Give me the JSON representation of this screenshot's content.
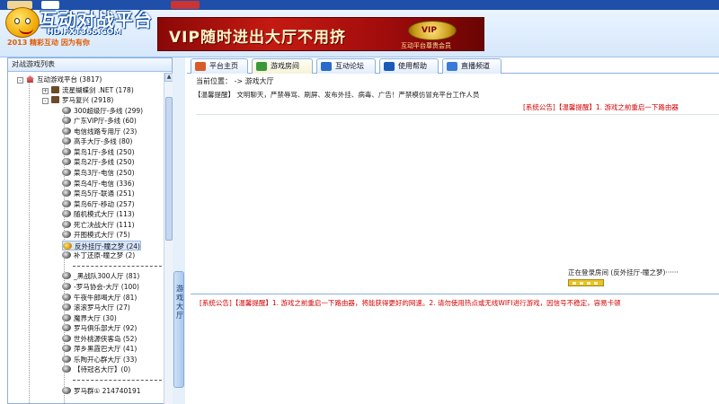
{
  "logo": {
    "title": "互动对战平台",
    "url": "HD.FXT365.COM",
    "slogan": "2013 精彩互动 因为有你"
  },
  "vip_banner": {
    "text": "VIP随时进出大厅不用挤",
    "badge": "VIP",
    "caption": "互动平台尊贵会员"
  },
  "left_panel": {
    "title": "对战游戏列表",
    "tree": [
      {
        "label": "互动游戏平台 (3817)",
        "level": 0,
        "icon": "house-icon",
        "expander": "-"
      },
      {
        "label": "流星蝴蝶剑 .NET (178)",
        "level": 1,
        "icon": "game-icon",
        "expander": "+"
      },
      {
        "label": "罗马复兴 (2918)",
        "level": 1,
        "icon": "game-icon",
        "expander": "-"
      },
      {
        "label": "300超级厅-多线 (299)",
        "level": 2,
        "icon": "room-icon"
      },
      {
        "label": "广东VIP厅-多线 (60)",
        "level": 2,
        "icon": "room-icon"
      },
      {
        "label": "电信线路专用厅 (23)",
        "level": 2,
        "icon": "room-icon"
      },
      {
        "label": "高手大厅-多线 (80)",
        "level": 2,
        "icon": "room-icon"
      },
      {
        "label": "菜鸟1厅-多线 (250)",
        "level": 2,
        "icon": "room-icon"
      },
      {
        "label": "菜鸟2厅-多线 (250)",
        "level": 2,
        "icon": "room-icon"
      },
      {
        "label": "菜鸟3厅-电信 (250)",
        "level": 2,
        "icon": "room-icon"
      },
      {
        "label": "菜鸟4厅-电信 (336)",
        "level": 2,
        "icon": "room-icon"
      },
      {
        "label": "菜鸟5厅-联通 (251)",
        "level": 2,
        "icon": "room-icon"
      },
      {
        "label": "菜鸟6厅-移动 (257)",
        "level": 2,
        "icon": "room-icon"
      },
      {
        "label": "随机模式大厅 (113)",
        "level": 2,
        "icon": "room-icon"
      },
      {
        "label": "死亡决战大厅 (111)",
        "level": 2,
        "icon": "room-icon"
      },
      {
        "label": "开图模式大厅 (75)",
        "level": 2,
        "icon": "room-icon"
      },
      {
        "label": "反外挂厅-瞳之梦 (24)",
        "level": 2,
        "icon": "gold-room-icon",
        "selected": true
      },
      {
        "label": "补丁还原-瞳之梦 (2)",
        "level": 2,
        "icon": "room-icon"
      },
      {
        "label": "-----------------------",
        "level": 2,
        "separator": true
      },
      {
        "label": "_黑战队300人厅 (81)",
        "level": 2,
        "icon": "room-icon"
      },
      {
        "label": "-罗马协会-大厅 (100)",
        "level": 2,
        "icon": "room-icon"
      },
      {
        "label": "午夜牛郎喝大厅 (81)",
        "level": 2,
        "icon": "room-icon"
      },
      {
        "label": "滚滚罗马大厅 (27)",
        "level": 2,
        "icon": "room-icon"
      },
      {
        "label": "魔界大厅 (30)",
        "level": 2,
        "icon": "room-icon"
      },
      {
        "label": "罗马俱乐部大厅 (92)",
        "level": 2,
        "icon": "room-icon"
      },
      {
        "label": "世外桃源侠客岛 (52)",
        "level": 2,
        "icon": "room-icon"
      },
      {
        "label": "萍乡黑霞巴大厅 (41)",
        "level": 2,
        "icon": "room-icon"
      },
      {
        "label": "乐陶开心群大厅 (33)",
        "level": 2,
        "icon": "room-icon"
      },
      {
        "label": "【待冠名大厅】(0)",
        "level": 2,
        "icon": "room-icon"
      },
      {
        "label": "-----------------------",
        "level": 2,
        "separator": true
      },
      {
        "label": "罗马群① 214740191",
        "level": 2,
        "icon": "room-icon"
      }
    ]
  },
  "splitter": {
    "label": "游戏大厅"
  },
  "tabs": [
    {
      "label": "平台主页",
      "icon": "home-icon",
      "color": "#d85a2a",
      "active": false
    },
    {
      "label": "游戏房间",
      "icon": "game-room-icon",
      "color": "#3a9a3a",
      "active": true
    },
    {
      "label": "互动论坛",
      "icon": "forum-icon",
      "color": "#2a6ac8",
      "active": false
    },
    {
      "label": "使用帮助",
      "icon": "help-icon",
      "color": "#1a5ab8",
      "active": false
    },
    {
      "label": "直播频道",
      "icon": "live-icon",
      "color": "#3a7ad8",
      "active": false
    }
  ],
  "content": {
    "location": "当前位置： -> 游戏大厅",
    "tip": "【温馨提醒】 文明聊天，严禁辱骂、刷屏、发布外挂、病毒、广告！严禁模仿冒充平台工作人员",
    "announcement_top": "[系统公告]【温馨提醒】1. 游戏之前重启一下路由器",
    "loading_text": "正在登录房间 (反外挂厅-瞳之梦)······",
    "announcement_bottom": "[系统公告]【温馨提醒】1. 游戏之前重启一下路由器，将能获得更好的网速。2. 请勿使用热点或无线WIFI进行游戏，因信号不稳定，容易卡顿"
  },
  "colors": {
    "header_bg": "#d6e8fb",
    "announcement_red": "#d40000",
    "border_blue": "#8ab0dd",
    "banner_red": "#c41a12"
  }
}
